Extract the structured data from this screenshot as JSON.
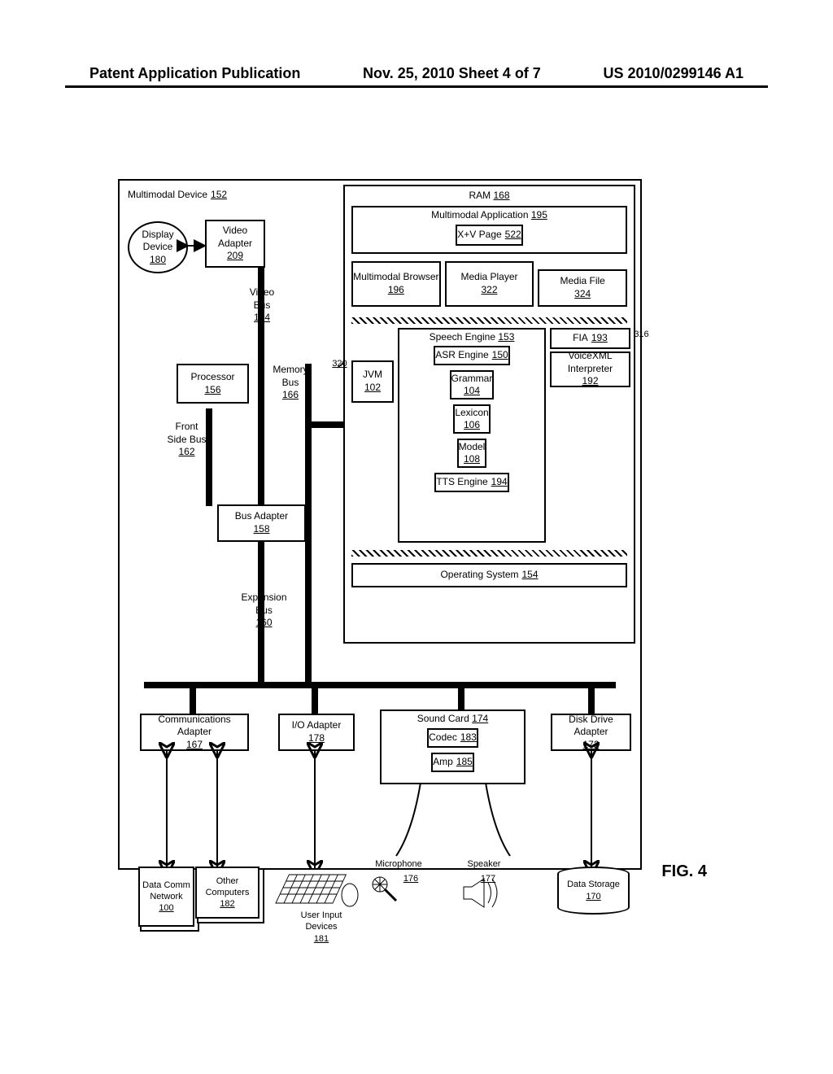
{
  "header": {
    "left": "Patent Application Publication",
    "center": "Nov. 25, 2010  Sheet 4 of 7",
    "right": "US 2010/0299146 A1"
  },
  "figlabel": "FIG. 4",
  "callout316": "316",
  "callout320": "320",
  "blocks": {
    "device": {
      "label": "Multimodal Device",
      "ref": "152"
    },
    "display": {
      "label": "Display Device",
      "ref": "180"
    },
    "vadapter": {
      "label": "Video Adapter",
      "ref": "209"
    },
    "vbus": {
      "label": "Video Bus",
      "ref": "164"
    },
    "ram": {
      "label": "RAM",
      "ref": "168"
    },
    "mapp": {
      "label": "Multimodal Application",
      "ref": "195"
    },
    "xvpage": {
      "label": "X+V Page",
      "ref": "522"
    },
    "mbrowser": {
      "label": "Multimodal Browser",
      "ref": "196"
    },
    "mplayer": {
      "label": "Media Player",
      "ref": "322"
    },
    "mfile": {
      "label": "Media File",
      "ref": "324"
    },
    "proc": {
      "label": "Processor",
      "ref": "156"
    },
    "mbus": {
      "label": "Memory Bus",
      "ref": "166"
    },
    "jvm": {
      "label": "JVM",
      "ref": "102"
    },
    "speech": {
      "label": "Speech Engine",
      "ref": "153"
    },
    "asr": {
      "label": "ASR Engine",
      "ref": "150"
    },
    "grammar": {
      "label": "Grammar",
      "ref": "104"
    },
    "lexicon": {
      "label": "Lexicon",
      "ref": "106"
    },
    "model": {
      "label": "Model",
      "ref": "108"
    },
    "tts": {
      "label": "TTS Engine",
      "ref": "194"
    },
    "fia": {
      "label": "FIA",
      "ref": "193"
    },
    "vxml": {
      "label": "VoiceXML Interpreter",
      "ref": "192"
    },
    "fsb": {
      "label": "Front Side Bus",
      "ref": "162"
    },
    "badapter": {
      "label": "Bus Adapter",
      "ref": "158"
    },
    "ebus": {
      "label": "Expansion Bus",
      "ref": "160"
    },
    "os": {
      "label": "Operating System",
      "ref": "154"
    },
    "comm": {
      "label": "Communications Adapter",
      "ref": "167"
    },
    "io": {
      "label": "I/O Adapter",
      "ref": "178"
    },
    "sound": {
      "label": "Sound Card",
      "ref": "174"
    },
    "codec": {
      "label": "Codec",
      "ref": "183"
    },
    "amp": {
      "label": "Amp",
      "ref": "185"
    },
    "disk": {
      "label": "Disk Drive Adapter",
      "ref": "172"
    },
    "dcn": {
      "label": "Data Comm Network",
      "ref": "100"
    },
    "other": {
      "label": "Other Computers",
      "ref": "182"
    },
    "uinput": {
      "label": "User Input Devices",
      "ref": "181"
    },
    "mic": {
      "label": "Microphone",
      "ref": "176"
    },
    "speaker": {
      "label": "Speaker",
      "ref": "177"
    },
    "storage": {
      "label": "Data Storage",
      "ref": "170"
    }
  }
}
